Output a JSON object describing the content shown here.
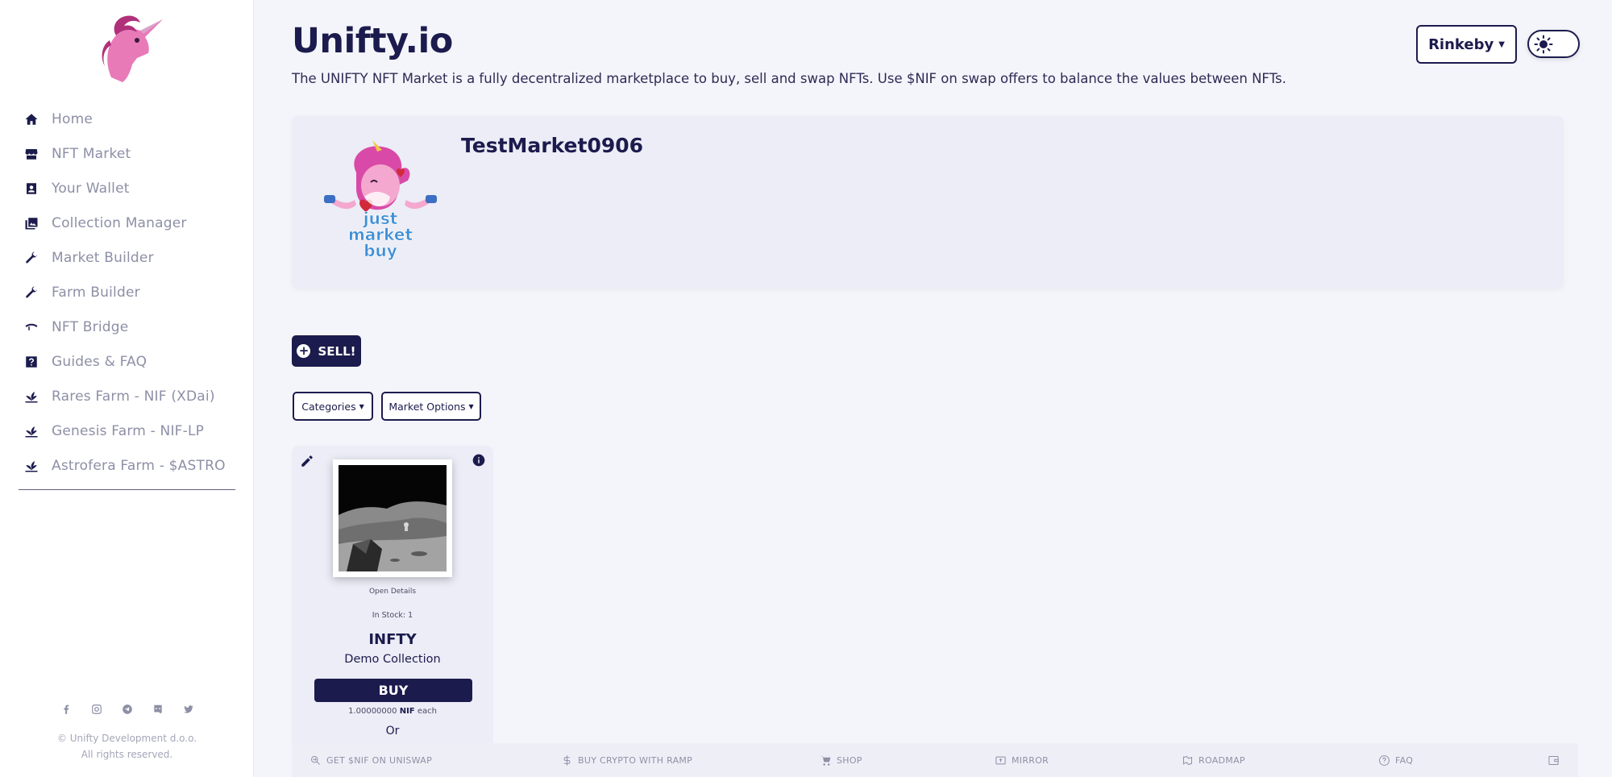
{
  "sidebar": {
    "items": [
      {
        "label": "Home",
        "icon": "home-icon"
      },
      {
        "label": "NFT Market",
        "icon": "store-icon"
      },
      {
        "label": "Your Wallet",
        "icon": "wallet-icon"
      },
      {
        "label": "Collection Manager",
        "icon": "collections-icon"
      },
      {
        "label": "Market Builder",
        "icon": "wrench-icon"
      },
      {
        "label": "Farm Builder",
        "icon": "wrench-icon"
      },
      {
        "label": "NFT Bridge",
        "icon": "bridge-icon"
      },
      {
        "label": "Guides & FAQ",
        "icon": "help-icon"
      },
      {
        "label": "Rares Farm - NIF (XDai)",
        "icon": "farm-icon"
      },
      {
        "label": "Genesis Farm - NIF-LP",
        "icon": "farm-icon"
      },
      {
        "label": "Astrofera Farm - $ASTRO",
        "icon": "farm-icon"
      }
    ],
    "socials": [
      "facebook-icon",
      "instagram-icon",
      "telegram-icon",
      "discord-icon",
      "twitter-icon"
    ],
    "copyright_line1": "© Unifty Development d.o.o.",
    "copyright_line2": "All rights reserved."
  },
  "header": {
    "title": "Unifty.io",
    "description": "The UNIFTY NFT Market is a fully decentralized marketplace to buy, sell and swap NFTs. Use $NIF on swap offers to balance the values between NFTs.",
    "network": "Rinkeby",
    "theme_icon": "sun-icon"
  },
  "market": {
    "name": "TestMarket0906",
    "avatar_text_1": "just",
    "avatar_text_2": "market",
    "avatar_text_3": "buy"
  },
  "actions": {
    "sell_label": "SELL!",
    "categories_label": "Categories",
    "market_options_label": "Market Options"
  },
  "nft": {
    "open_details": "Open Details",
    "in_stock": "In Stock: 1",
    "name": "INFTY",
    "collection": "Demo Collection",
    "buy_label": "BUY",
    "price_amount": "1.00000000",
    "price_currency": "NIF",
    "price_suffix": "each",
    "or_label": "Or"
  },
  "footer": {
    "items": [
      {
        "label": "GET $NIF ON UNISWAP",
        "icon": "swap-icon"
      },
      {
        "label": "BUY CRYPTO WITH RAMP",
        "icon": "dollar-icon"
      },
      {
        "label": "SHOP",
        "icon": "cart-icon"
      },
      {
        "label": "MIRROR",
        "icon": "mirror-icon"
      },
      {
        "label": "ROADMAP",
        "icon": "roadmap-icon"
      },
      {
        "label": "FAQ",
        "icon": "question-icon"
      }
    ]
  },
  "colors": {
    "primary": "#1c1b4d",
    "muted": "#8d8fa6",
    "background": "#f4f5fa",
    "card": "#ecedf6",
    "brand_pink": "#e86fb8"
  }
}
